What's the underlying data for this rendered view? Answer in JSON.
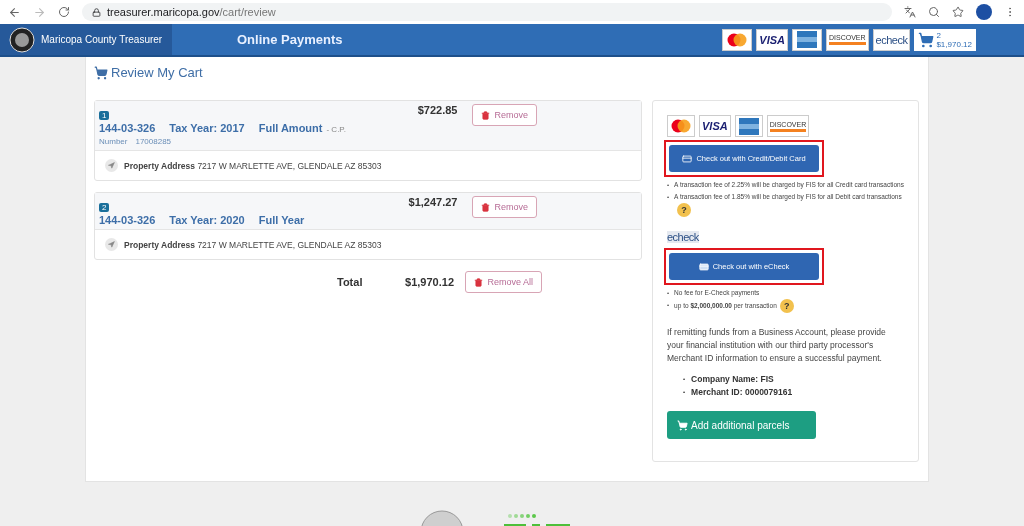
{
  "browser": {
    "url_host": "treasurer.maricopa.gov",
    "url_path": "/cart/review"
  },
  "header": {
    "brand": "Maricopa County Treasurer",
    "title": "Online Payments",
    "card_logos": [
      {
        "kind": "mastercard"
      },
      {
        "kind": "visa",
        "label": "VISA"
      },
      {
        "kind": "amex"
      },
      {
        "kind": "discover",
        "label": "DISCOVER"
      },
      {
        "kind": "echeck",
        "label": "echeck"
      }
    ],
    "cart": {
      "count": "2",
      "total": "$1,970.12"
    }
  },
  "cart": {
    "heading": "Review My Cart",
    "items": [
      {
        "index": "1",
        "parcel": "144-03-326",
        "tax_year": "Tax Year: 2017",
        "type": "Full Amount",
        "suffix": "- C.P.",
        "number_label": "Number",
        "number": "17008285",
        "amount": "$722.85",
        "remove": "Remove",
        "address_label": "Property Address",
        "address": "7217 W MARLETTE AVE, GLENDALE AZ 85303"
      },
      {
        "index": "2",
        "parcel": "144-03-326",
        "tax_year": "Tax Year: 2020",
        "type": "Full Year",
        "amount": "$1,247.27",
        "remove": "Remove",
        "address_label": "Property Address",
        "address": "7217 W MARLETTE AVE, GLENDALE AZ 85303"
      }
    ],
    "total_label": "Total",
    "total": "$1,970.12",
    "remove_all": "Remove All"
  },
  "checkout": {
    "card_logos": [
      {
        "kind": "mastercard"
      },
      {
        "kind": "visa",
        "label": "VISA"
      },
      {
        "kind": "amex"
      },
      {
        "kind": "discover",
        "label": "DISCOVER"
      }
    ],
    "options": [
      {
        "kind": "card",
        "button": "Check out with Credit/Debit Card",
        "highlighted": true,
        "notes": [
          {
            "text": "A transaction fee of 2.25% will be charged by FIS for all Credit card transactions",
            "help": false
          },
          {
            "text": "A transaction fee of 1.85% will be charged by FIS for all Debit card transactions",
            "help": true
          }
        ]
      },
      {
        "kind": "echeck",
        "logo": "echeck",
        "button": "Check out with eCheck",
        "highlighted": true,
        "notes": [
          {
            "text": "No fee for E-Check payments",
            "help": false
          },
          {
            "text": "up to **$2,000,000.00** per transaction",
            "help": true
          }
        ]
      }
    ],
    "help_mark": "?",
    "bullet": "•",
    "business_note": "If remitting funds from a Business Account, please provide your financial institution with our third party processor's Merchant ID information to ensure a successful payment.",
    "merchant": [
      "Company Name: FIS",
      "Merchant ID: 0000079161"
    ],
    "add_button": "Add additional parcels"
  }
}
